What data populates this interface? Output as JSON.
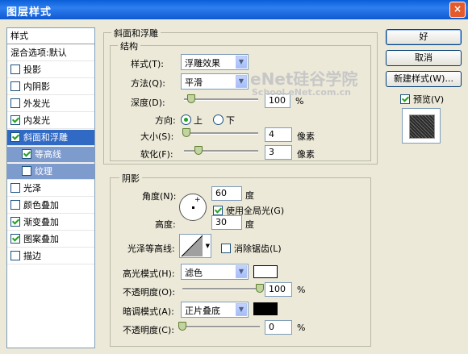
{
  "window": {
    "title": "图层样式",
    "close": "×"
  },
  "sidebar": {
    "header": "样式",
    "blend": "混合选项:默认",
    "items": [
      {
        "label": "投影",
        "checked": false
      },
      {
        "label": "内阴影",
        "checked": false
      },
      {
        "label": "外发光",
        "checked": false
      },
      {
        "label": "内发光",
        "checked": true
      },
      {
        "label": "斜面和浮雕",
        "checked": true
      },
      {
        "label": "等高线",
        "checked": true
      },
      {
        "label": "纹理",
        "checked": false
      },
      {
        "label": "光泽",
        "checked": false
      },
      {
        "label": "颜色叠加",
        "checked": false
      },
      {
        "label": "渐变叠加",
        "checked": true
      },
      {
        "label": "图案叠加",
        "checked": true
      },
      {
        "label": "描边",
        "checked": false
      }
    ]
  },
  "bevel": {
    "group_title": "斜面和浮雕",
    "structure_title": "结构",
    "style_label": "样式(T):",
    "style_value": "浮雕效果",
    "technique_label": "方法(Q):",
    "technique_value": "平滑",
    "depth_label": "深度(D):",
    "depth_value": "100",
    "depth_unit": "%",
    "depth_fraction": 0.1,
    "direction_label": "方向:",
    "dir_up": "上",
    "dir_down": "下",
    "size_label": "大小(S):",
    "size_value": "4",
    "size_unit": "像素",
    "size_fraction": 0.03,
    "soften_label": "软化(F):",
    "soften_value": "3",
    "soften_unit": "像素",
    "soften_fraction": 0.2
  },
  "shading": {
    "title": "阴影",
    "angle_label": "角度(N):",
    "angle_value": "60",
    "angle_unit": "度",
    "global_light": "使用全局光(G)",
    "altitude_label": "高度:",
    "altitude_value": "30",
    "altitude_unit": "度",
    "gloss_label": "光泽等高线:",
    "antialias": "消除锯齿(L)",
    "highlight_label": "高光模式(H):",
    "highlight_value": "滤色",
    "highlight_color": "#ffffff",
    "hl_opacity_label": "不透明度(O):",
    "hl_opacity_value": "100",
    "hl_opacity_unit": "%",
    "hl_opacity_fraction": 1.0,
    "shadow_label": "暗调模式(A):",
    "shadow_value": "正片叠底",
    "shadow_color": "#000000",
    "sh_opacity_label": "不透明度(C):",
    "sh_opacity_value": "0",
    "sh_opacity_unit": "%",
    "sh_opacity_fraction": 0.0
  },
  "buttons": {
    "ok": "好",
    "cancel": "取消",
    "new_style": "新建样式(W)...",
    "preview": "预览(V)"
  },
  "watermark": {
    "line1": "eNet硅谷学院",
    "line2": "School.eNet.com.cn"
  }
}
